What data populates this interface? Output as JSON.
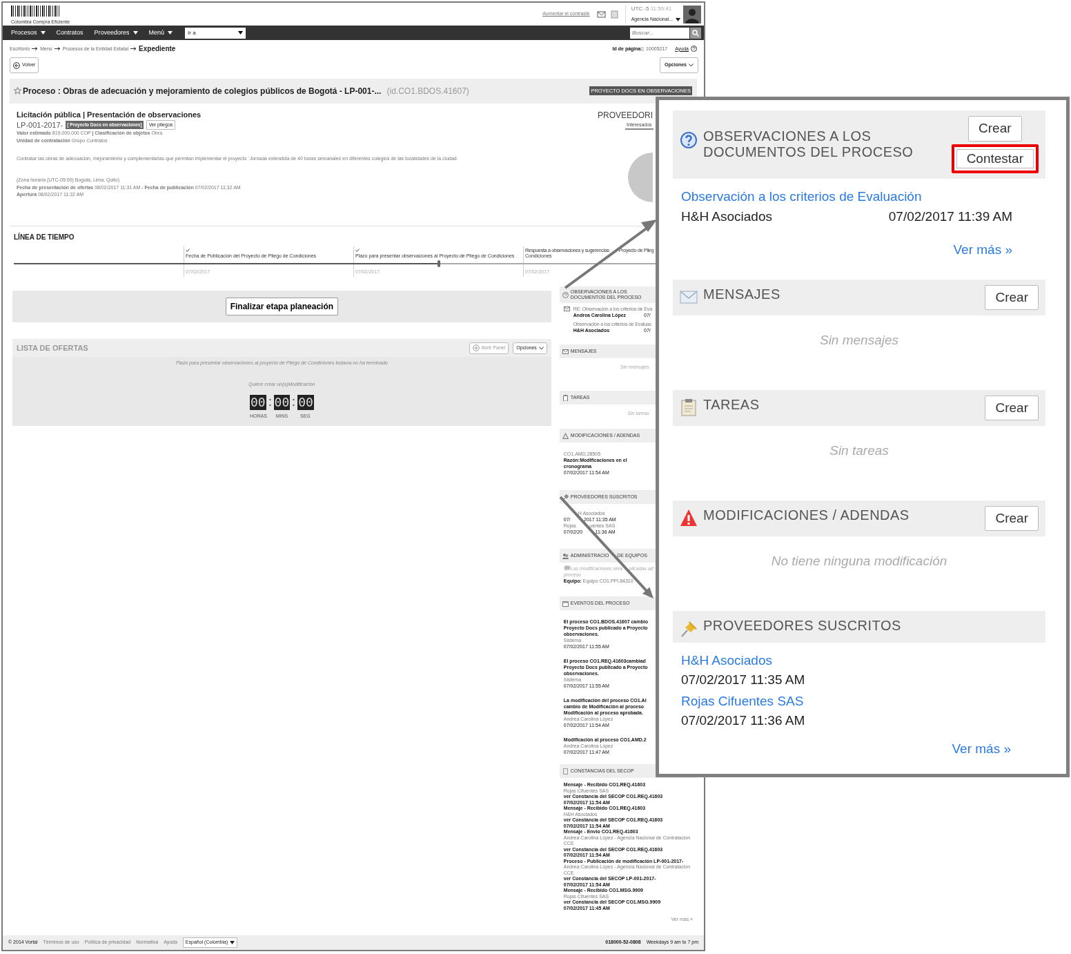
{
  "header": {
    "logo_caption": "Colombia Compra Eficiente",
    "contrast_link": "Aumentar el contraste",
    "timezone": "UTC -5",
    "time": "11:55:41",
    "agency": "Agencia Nacional..."
  },
  "nav": {
    "items": [
      {
        "label": "Procesos",
        "dropdown": true
      },
      {
        "label": "Contratos",
        "dropdown": false
      },
      {
        "label": "Proveedores",
        "dropdown": true
      },
      {
        "label": "Menú",
        "dropdown": true
      }
    ],
    "goto": "Ir a",
    "search_placeholder": "Buscar..."
  },
  "breadcrumb": [
    "Escritorio",
    "Menú",
    "Procesos de la Entidad Estatal",
    "Expediente"
  ],
  "page_id_label": "Id de página::",
  "page_id": "10005217",
  "help": "Ayuda",
  "back_button": "Volver",
  "options_button": "Opciones",
  "process": {
    "title": "Proceso : Obras de adecuación y mejoramiento de colegios públicos de Bogotá  - LP-001-...",
    "id": "(id.CO1.BDOS.41607)",
    "status": "PROYECTO DOCS EN OBSERVACIONES",
    "type_line": "Licitación pública | Presentación de observaciones",
    "code": "LP-001-2017-",
    "code_badge": "[ Proyecto Docs en observaciones]",
    "pliegos_button": "Ver pliegos",
    "info_lines": [
      "**Valor estimado** 819.000.000 COP **| Clasificación de objetos**  Obra",
      "**Unidad de contratación** Grupo Contratos"
    ],
    "description": "Contratar las obras de adecuación, mejoramiento y complementarias que permitan implementar el proyecto `Jornada extendida de 40 horas semanales´en diferentes colegios de las localidades de la ciudad.",
    "date_lines": [
      "(Zona horaria (UTC-05:00) Bogotá, Lima, Quito)",
      "**Fecha de presentación de ofertas** 08/02/2017 11:31 AM **- Fecha de publicación** 07/02/2017 11:32 AM",
      "**Apertura** 08/02/2017 11:32 AM"
    ],
    "providers_title": "PROVEEDORI",
    "providers_tab": "Interesados"
  },
  "timeline": {
    "title": "LÍNEA DE TIEMPO",
    "level": 0.66,
    "milestones": [
      {
        "label": "Fecha de Publicación del Proyecto de Pliego de Condiciones",
        "date": "07/02/2017",
        "done": true
      },
      {
        "label": "Plazo para presentar observaciones al Proyecto de Pliego de Condiciones",
        "date": "07/02/2017",
        "done": true
      },
      {
        "label": "Respuesta a observaciones y sugerencias",
        "label_tail": "Proyecto de Plieg",
        "label2": "Condiciones",
        "date": "07/02/2017",
        "done": false
      }
    ]
  },
  "finalize_button": "Finalizar etapa planeación",
  "offers": {
    "title": "LISTA DE OFERTAS",
    "open_panel": "Abrir Panel",
    "options": "Opciones",
    "notice": "Plazo para presentar observaciones al proyecto de Pliego de Condiciones todavía no ha terminado",
    "question": "Quiere crear un(a)Modificación",
    "countdown": [
      {
        "value": "00",
        "unit": "HORAS"
      },
      {
        "value": "00",
        "unit": "MINS"
      },
      {
        "value": "00",
        "unit": "SEG"
      }
    ]
  },
  "sidebar": [
    {
      "kind": "observations",
      "title": "OBSERVACIONES A LOS DOCUMENTOS DEL PROCESO",
      "items": [
        {
          "kind": "reply",
          "subject": "RE: Observación a los criterios de Eva",
          "author": "Andrea Carolina López",
          "date": "07/"
        },
        {
          "kind": "plain",
          "subject": "Observación a los criterios de Evaluac",
          "author": "H&H Asociados",
          "date": "07/"
        }
      ]
    },
    {
      "kind": "messages",
      "title": "MENSAJES",
      "empty": "Sin mensajes"
    },
    {
      "kind": "tasks",
      "title": "TAREAS",
      "empty": "Sin tareas"
    },
    {
      "kind": "modifications",
      "title": "MODIFICACIONES / ADENDAS",
      "items": [
        {
          "code": "CO1.AMD.28505",
          "reason": "Razón:Modificaciones en el cronograma",
          "date": "07/02/2017 11:54 AM"
        }
      ]
    },
    {
      "kind": "subscribers",
      "title": "PROVEEDORES SUSCRITOS",
      "items": [
        {
          "name_parts": [
            "H Asociados"
          ],
          "date_parts": [
            "07/",
            "2017 11:35 AM"
          ]
        },
        {
          "name_parts": [
            "Rojas",
            "uentes SAS"
          ],
          "date_parts": [
            "07/02/20",
            "11:36 AM"
          ]
        }
      ]
    },
    {
      "kind": "team",
      "title_parts": [
        "ADMINISTRACIO",
        "DE EQUIPOS"
      ],
      "note_lines": [
        [
          "Las modificaciones sera",
          "plicadas ad"
        ],
        [
          "proceso"
        ]
      ],
      "team_label": "Equipo:",
      "team_value": "Equipo CO1.PPI.84310"
    },
    {
      "kind": "events",
      "title": "EVENTOS DEL PROCESO",
      "items": [
        {
          "lines": [
            "El proceso CO1.BDOS.41607 cambio",
            "Proyecto Docs publicado a Proyecto",
            "observaciones."
          ],
          "author": "Sistema",
          "date": "07/02/2017 11:55 AM"
        },
        {
          "lines": [
            "El proceso CO1.REQ.41603cambiad",
            "Proyecto Docs publicado a Proyecto",
            "observaciones."
          ],
          "author": "Sistema",
          "date": "07/02/2017 11:55 AM"
        },
        {
          "lines": [
            "La modificación del proceso CO1.AI",
            "cambio de Modificación al proceso",
            "Modificación al proceso aprobada."
          ],
          "author": "Andrea Carolina López",
          "date": "07/02/2017 11:54 AM"
        },
        {
          "lines": [
            "Modificación al proceso CO1.AMD.2"
          ],
          "author": "Andrea Carolina López",
          "date": "07/02/2017 11:47 AM"
        }
      ]
    },
    {
      "kind": "certificates",
      "title": "CONSTANCIAS DEL SECOP",
      "more": "Ver más »",
      "items": [
        {
          "title": "Mensaje - Recibido CO1.REQ.41603",
          "source": "Rojas Cifuentes SAS",
          "link": "ver Constancia del SECOP CO1.REQ.41603",
          "date": "07/02/2017 11:54 AM"
        },
        {
          "title": "Mensaje - Recibido CO1.REQ.41603",
          "source": "H&H Asociados",
          "link": "ver Constancia del SECOP CO1.REQ.41603",
          "date": "07/02/2017 11:54 AM"
        },
        {
          "title": "Mensaje - Envio CO1.REQ.41603",
          "source": "Andrea Carolina López - Agencia Nacional de Contratación CCE",
          "link": "ver Constancia del SECOP CO1.REQ.41603",
          "date": "07/02/2017 11:54 AM"
        },
        {
          "title": "Proceso - Publicación de modificación LP-001-2017-",
          "source": "Andrea Carolina López - Agencia Nacional de Contratación CCE",
          "link": "ver Constancia del SECOP LP-001-2017-",
          "date": "07/02/2017 11:54 AM"
        },
        {
          "title": "Mensaje - Recibido CO1.MSG.9909",
          "source": "Rojas Cifuentes SAS",
          "link": "ver Constancia del SECOP CO1.MSG.9909",
          "date": "07/02/2017 11:45 AM"
        }
      ]
    }
  ],
  "footer": {
    "copyright": "© 2014 Vortal",
    "links": [
      "Términos de uso",
      "Política de privacidad",
      "Normativa",
      "Ayuda"
    ],
    "language": "Español (Colombia)",
    "phone": "018000-52-0808",
    "hours": "Weekdays 9 am to 7 pm"
  },
  "zoom_panel": [
    {
      "kind": "observations",
      "title": "OBSERVACIONES A LOS DOCUMENTOS DEL PROCESO",
      "buttons": [
        {
          "label": "Crear",
          "highlighted": false
        },
        {
          "label": "Contestar",
          "highlighted": true
        }
      ],
      "items": [
        {
          "link": "Observación a los criterios de Evaluación",
          "author": "H&H Asociados",
          "date": "07/02/2017 11:39 AM"
        }
      ],
      "more": "Ver más »"
    },
    {
      "kind": "messages",
      "title": "MENSAJES",
      "buttons": [
        {
          "label": "Crear",
          "highlighted": false
        }
      ],
      "empty": "Sin mensajes"
    },
    {
      "kind": "tasks",
      "title": "TAREAS",
      "buttons": [
        {
          "label": "Crear",
          "highlighted": false
        }
      ],
      "empty": "Sin tareas"
    },
    {
      "kind": "modifications",
      "title": "MODIFICACIONES / ADENDAS",
      "buttons": [
        {
          "label": "Crear",
          "highlighted": false
        }
      ],
      "empty": "No tiene ninguna modificación"
    },
    {
      "kind": "subscribers",
      "title": "PROVEEDORES SUSCRITOS",
      "subscribers": [
        {
          "link": "H&H Asociados",
          "date": "07/02/2017 11:35 AM"
        },
        {
          "link": "Rojas Cifuentes SAS",
          "date": "07/02/2017 11:36 AM"
        }
      ],
      "more": "Ver más »"
    }
  ]
}
